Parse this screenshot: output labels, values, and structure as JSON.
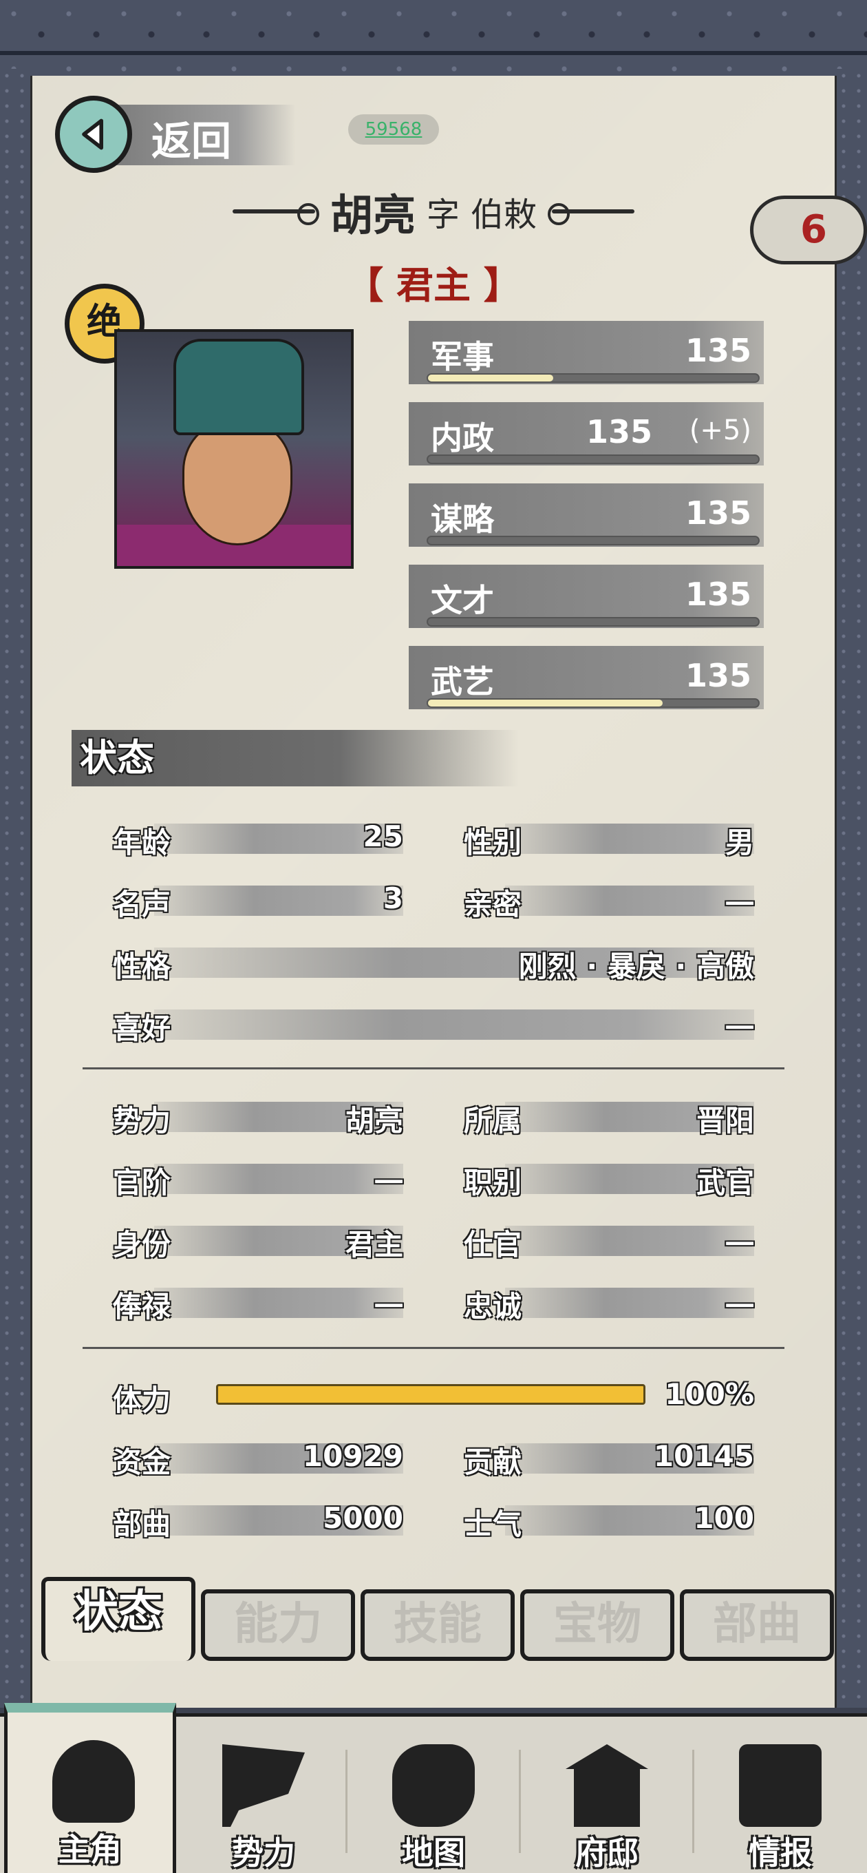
{
  "header": {
    "back_label": "返回",
    "uid": "59568"
  },
  "character": {
    "name": "胡亮",
    "zi_label": "字",
    "courtesy_name": "伯敕",
    "role": "【 君主 】",
    "rank_badge": "绝",
    "corner_badge": "6"
  },
  "attributes": [
    {
      "label": "军事",
      "value": "135",
      "bar_fraction": 0.38
    },
    {
      "label": "内政",
      "value": "135",
      "bonus": "(+5)",
      "bar_fraction": 0
    },
    {
      "label": "谋略",
      "value": "135",
      "bar_fraction": 0
    },
    {
      "label": "文才",
      "value": "135",
      "bar_fraction": 0
    },
    {
      "label": "武艺",
      "value": "135",
      "bar_fraction": 0.71
    }
  ],
  "status": {
    "header": "状态",
    "age_label": "年龄",
    "age": "25",
    "gender_label": "性别",
    "gender": "男",
    "fame_label": "名声",
    "fame": "3",
    "intimacy_label": "亲密",
    "intimacy": "一",
    "personality_label": "性格",
    "personality": "刚烈 · 暴戾 · 高傲",
    "hobby_label": "喜好",
    "hobby": "一",
    "force_label": "势力",
    "force": "胡亮",
    "affiliation_label": "所属",
    "affiliation": "晋阳",
    "rank_label": "官阶",
    "rank": "一",
    "job_label": "职别",
    "job": "武官",
    "identity_label": "身份",
    "identity": "君主",
    "office_label": "仕官",
    "office": "一",
    "salary_label": "俸禄",
    "salary": "一",
    "loyalty_label": "忠诚",
    "loyalty": "一",
    "stamina_label": "体力",
    "stamina": "100%",
    "stamina_fraction": 1.0,
    "funds_label": "资金",
    "funds": "10929",
    "contribution_label": "贡献",
    "contribution": "10145",
    "troops_label": "部曲",
    "troops": "5000",
    "morale_label": "士气",
    "morale": "100"
  },
  "tabs": [
    "状态",
    "能力",
    "技能",
    "宝物",
    "部曲"
  ],
  "nav": [
    "主角",
    "势力",
    "地图",
    "府邸",
    "情报"
  ],
  "colors": {
    "panel": "#e9e5d8",
    "role_red": "#9e1d15",
    "stamina_yellow": "#f2bf35",
    "back_teal": "#8fc8bd",
    "badge_gold": "#f1c64d"
  }
}
